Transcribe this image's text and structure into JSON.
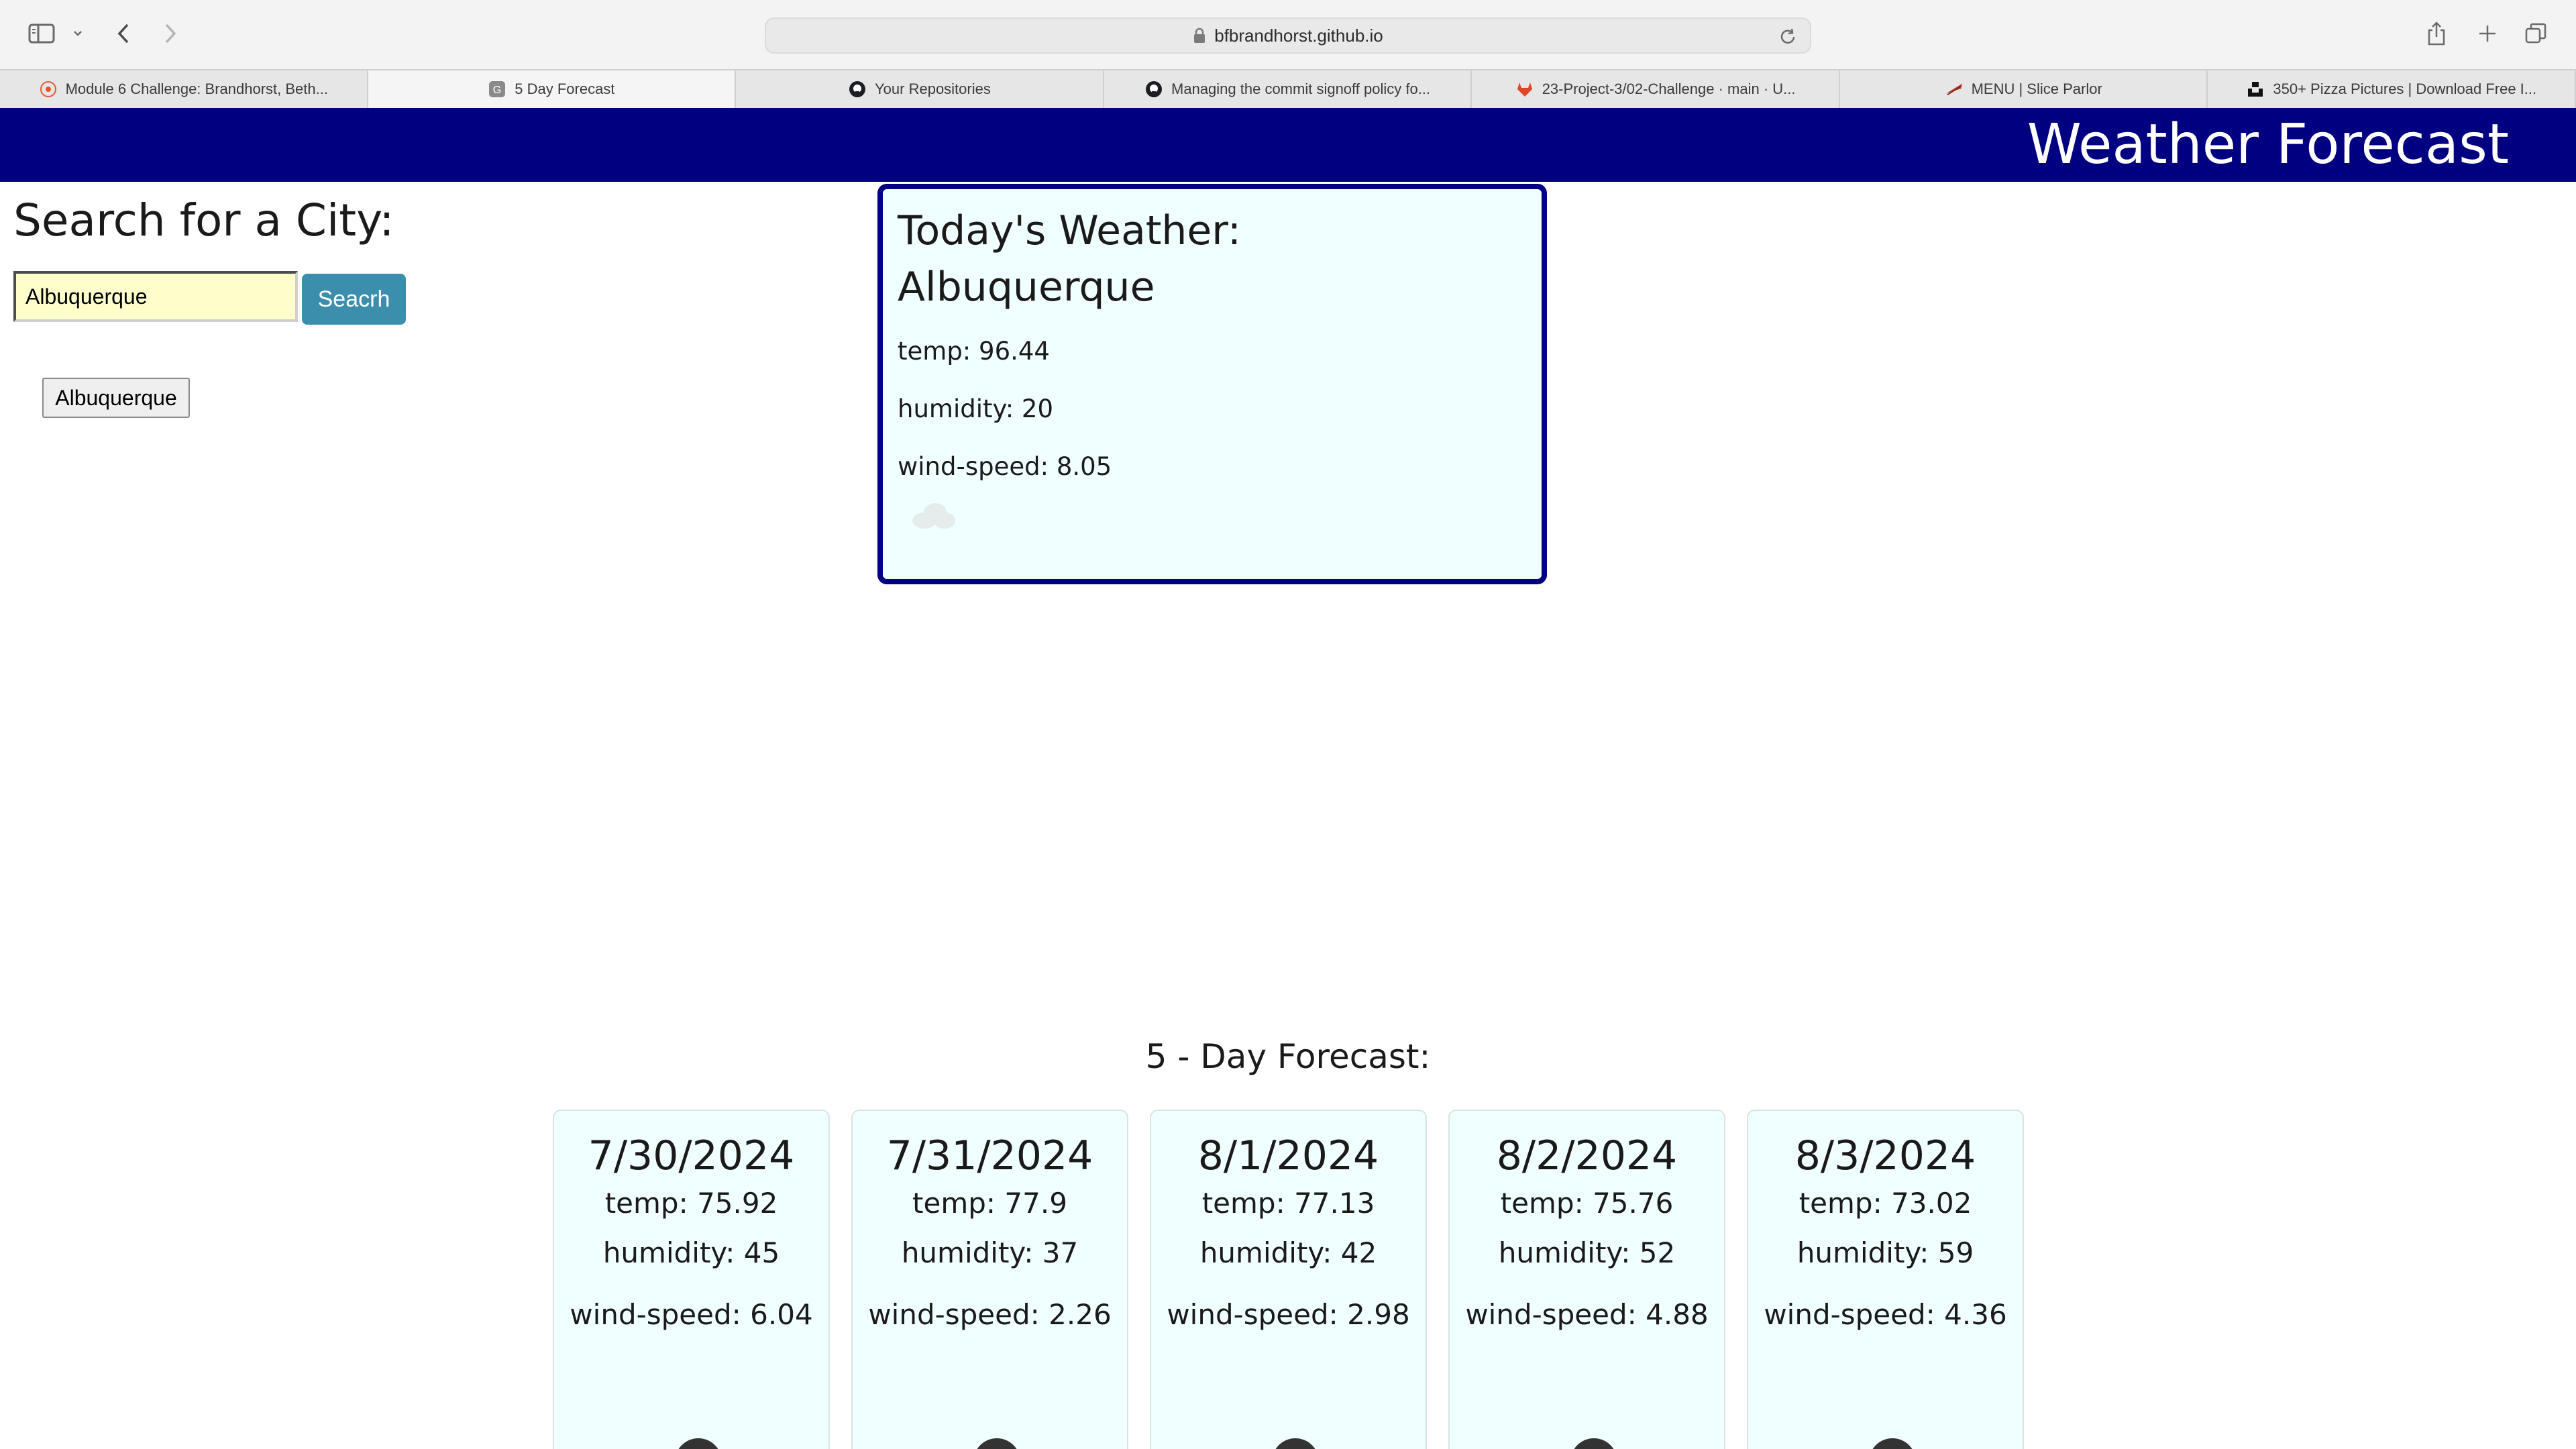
{
  "browser": {
    "url": "bfbrandhorst.github.io",
    "tabs": [
      {
        "title": "Module 6 Challenge: Brandhorst, Beth...",
        "favicon": "canvas-icon",
        "active": false
      },
      {
        "title": "5 Day Forecast",
        "favicon": "g-icon",
        "active": true
      },
      {
        "title": "Your Repositories",
        "favicon": "github-icon",
        "active": false
      },
      {
        "title": "Managing the commit signoff policy fo...",
        "favicon": "github-icon",
        "active": false
      },
      {
        "title": "23-Project-3/02-Challenge · main · U...",
        "favicon": "gitlab-icon",
        "active": false
      },
      {
        "title": "MENU | Slice Parlor",
        "favicon": "pizza-icon",
        "active": false
      },
      {
        "title": "350+ Pizza Pictures | Download Free I...",
        "favicon": "unsplash-icon",
        "active": false
      }
    ]
  },
  "header": {
    "title": "Weather Forecast"
  },
  "search": {
    "title": "Search for a City:",
    "input_value": "Albuquerque",
    "button_label": "Seacrh",
    "history": [
      "Albuquerque"
    ]
  },
  "today": {
    "heading": "Today's Weather:",
    "city": "Albuquerque",
    "temp": "temp: 96.44",
    "humidity": "humidity: 20",
    "wind": "wind-speed: 8.05",
    "icon": "cloud-icon"
  },
  "forecast": {
    "title": "5 - Day Forecast:",
    "days": [
      {
        "date": "7/30/2024",
        "temp": "temp: 75.92",
        "humidity": "humidity: 45",
        "wind": "wind-speed: 6.04"
      },
      {
        "date": "7/31/2024",
        "temp": "temp: 77.9",
        "humidity": "humidity: 37",
        "wind": "wind-speed: 2.26"
      },
      {
        "date": "8/1/2024",
        "temp": "temp: 77.13",
        "humidity": "humidity: 42",
        "wind": "wind-speed: 2.98"
      },
      {
        "date": "8/2/2024",
        "temp": "temp: 75.76",
        "humidity": "humidity: 52",
        "wind": "wind-speed: 4.88"
      },
      {
        "date": "8/3/2024",
        "temp": "temp: 73.02",
        "humidity": "humidity: 59",
        "wind": "wind-speed: 4.36"
      }
    ]
  },
  "colors": {
    "header_bg": "#000080",
    "card_bg": "#f0ffff",
    "search_button": "#3b8fad",
    "input_bg": "#ffffcc"
  }
}
